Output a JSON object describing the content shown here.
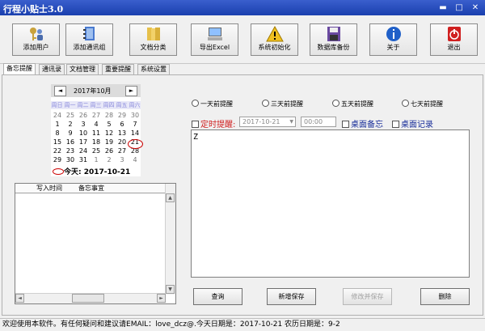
{
  "window": {
    "title": "行程小贴士3.0"
  },
  "toolbar": [
    {
      "label": "添加用户",
      "icon": "key-user-icon"
    },
    {
      "label": "添加通讯组",
      "icon": "address-book-icon"
    },
    {
      "label": "文档分类",
      "icon": "folder-icon"
    },
    {
      "label": "导出Excel",
      "icon": "monitor-icon"
    },
    {
      "label": "系统初始化",
      "icon": "warning-icon"
    },
    {
      "label": "数据库备份",
      "icon": "floppy-disk-icon"
    },
    {
      "label": "关于",
      "icon": "info-icon"
    },
    {
      "label": "退出",
      "icon": "power-icon"
    }
  ],
  "tabs": [
    "备忘提醒",
    "通讯录",
    "文档管理",
    "重要提醒",
    "系统设置"
  ],
  "calendar": {
    "prev": "◄",
    "next": "►",
    "month_title": "2017年10月",
    "weekdays": [
      "周日",
      "周一",
      "周二",
      "周三",
      "周四",
      "周五",
      "周六"
    ],
    "weeks": [
      [
        "24",
        "25",
        "26",
        "27",
        "28",
        "29",
        "30"
      ],
      [
        "1",
        "2",
        "3",
        "4",
        "5",
        "6",
        "7"
      ],
      [
        "8",
        "9",
        "10",
        "11",
        "12",
        "13",
        "14"
      ],
      [
        "15",
        "16",
        "17",
        "18",
        "19",
        "20",
        "21"
      ],
      [
        "22",
        "23",
        "24",
        "25",
        "26",
        "27",
        "28"
      ],
      [
        "29",
        "30",
        "31",
        "1",
        "2",
        "3",
        "4"
      ]
    ],
    "today_label": "今天: 2017-10-21"
  },
  "list": {
    "columns": [
      "写入时间",
      "备忘事宜"
    ]
  },
  "remind": {
    "radios": [
      "一天前提醒",
      "三天前提醒",
      "五天前提醒",
      "七天前提醒"
    ],
    "timed_label": "定时提醒:",
    "date_value": "2017-10-21",
    "time_value": "00:00",
    "desk_memo": "桌面备忘",
    "desk_record": "桌面记录"
  },
  "memo": {
    "text": "Z"
  },
  "actions": {
    "query": "查询",
    "save_new": "新增保存",
    "modify_save": "修改并保存",
    "delete": "删除"
  },
  "status": {
    "text": "欢迎使用本软件。有任何疑问和建议请EMAIL：love_dcz@.今天日期是：2017-10-21  农历日期是：9-2"
  }
}
